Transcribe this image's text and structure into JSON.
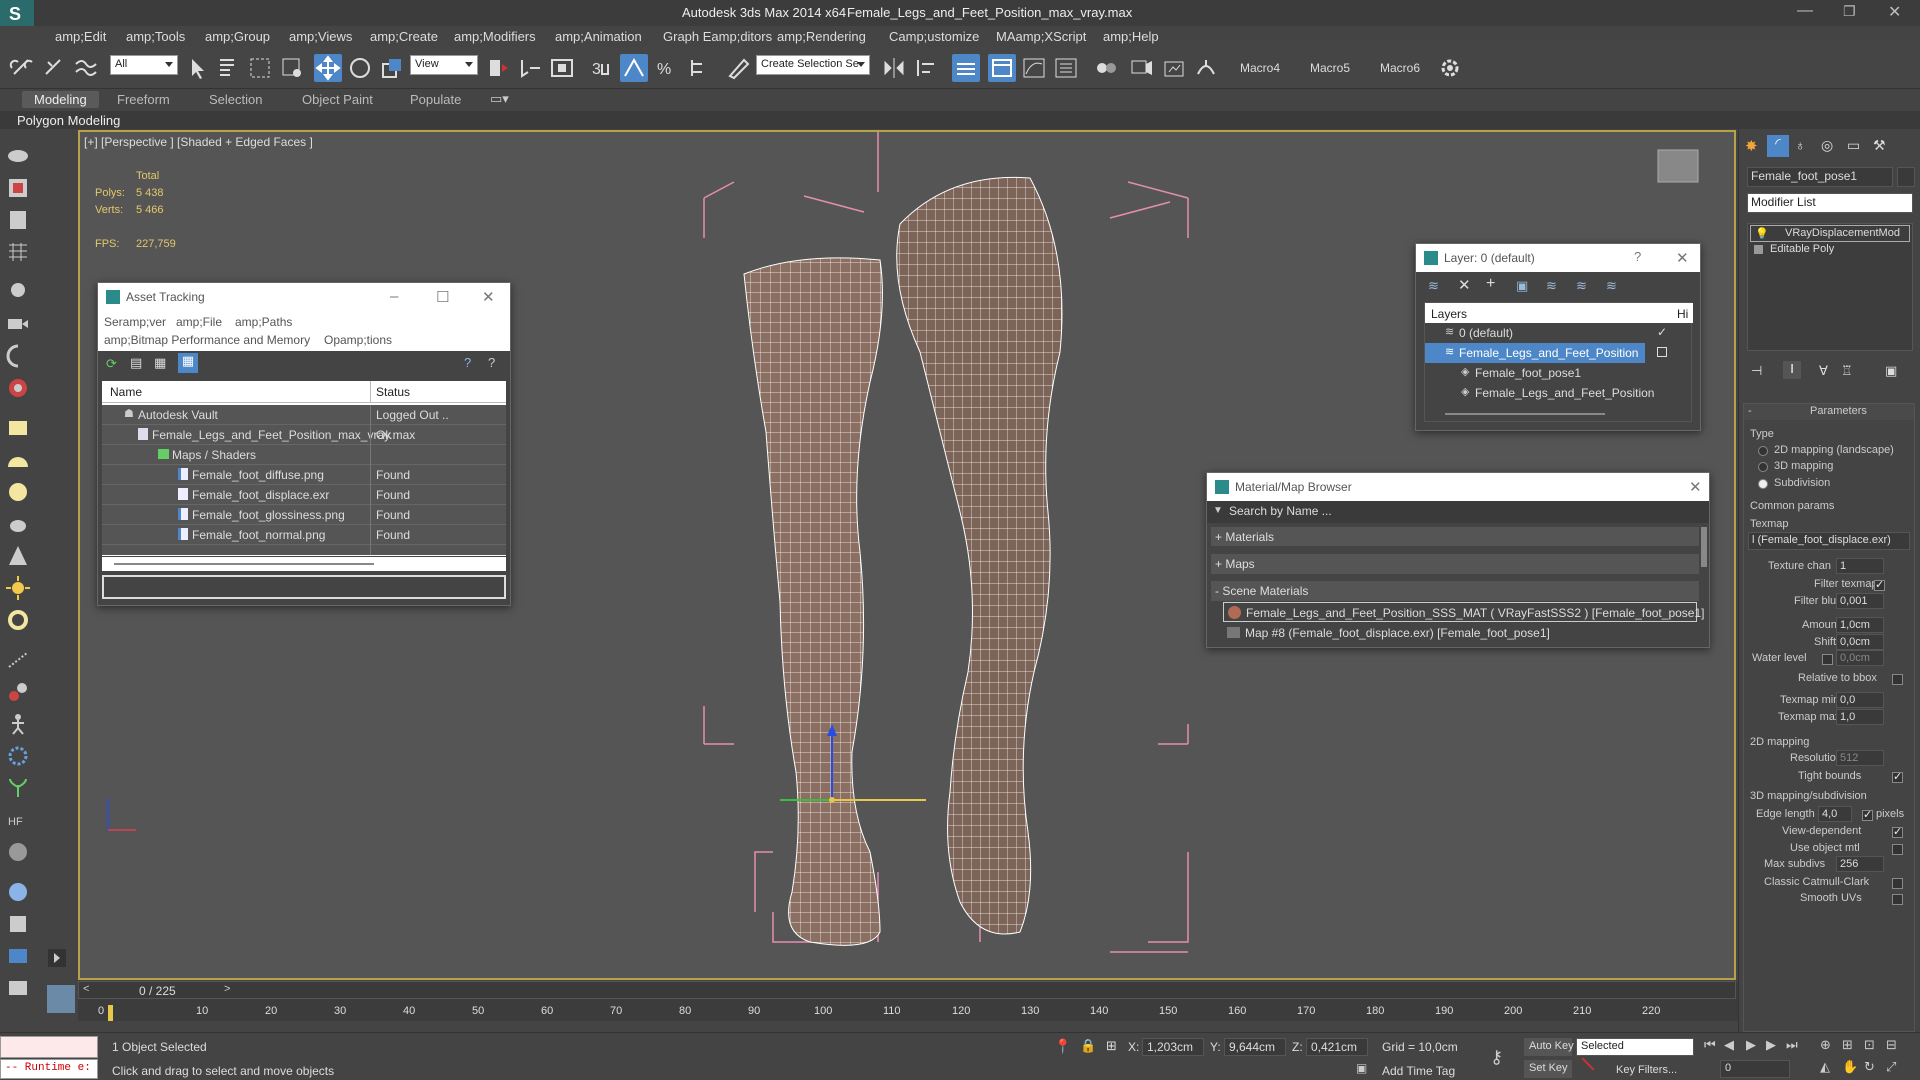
{
  "title": {
    "app": "Autodesk 3ds Max  2014 x64",
    "file": "Female_Legs_and_Feet_Position_max_vray.max"
  },
  "menu": [
    "amp;Edit",
    "amp;Tools",
    "amp;Group",
    "amp;Views",
    "amp;Create",
    "amp;Modifiers",
    "amp;Animation",
    "Graph Eamp;ditors",
    "amp;Rendering",
    "Camp;ustomize",
    "MAamp;XScript",
    "amp;Help"
  ],
  "toolbar": {
    "filter": "All",
    "ref_coord": "View",
    "selection_set": "Create Selection Se",
    "macros": [
      "Macro4",
      "Macro5",
      "Macro6"
    ]
  },
  "ribbon": {
    "tabs": [
      "Modeling",
      "Freeform",
      "Selection",
      "Object Paint",
      "Populate"
    ],
    "sub": "Polygon Modeling"
  },
  "viewport": {
    "label": "[+] [Perspective ] [Shaded + Edged Faces ]",
    "stats": {
      "total": "Total",
      "polys_label": "Polys:",
      "polys": "5 438",
      "verts_label": "Verts:",
      "verts": "5 466",
      "fps_label": "FPS:",
      "fps": "227,759"
    }
  },
  "asset_tracking": {
    "title": "Asset Tracking",
    "menu": [
      "Seramp;ver",
      "amp;File",
      "amp;Paths"
    ],
    "menu2": [
      "amp;Bitmap Performance and Memory",
      "Opamp;tions"
    ],
    "columns": [
      "Name",
      "Status"
    ],
    "rows": [
      {
        "name": "Autodesk Vault",
        "status": "Logged Out .."
      },
      {
        "name": "Female_Legs_and_Feet_Position_max_vray.max",
        "status": "Ok"
      },
      {
        "name": "Maps / Shaders",
        "status": ""
      },
      {
        "name": "Female_foot_diffuse.png",
        "status": "Found"
      },
      {
        "name": "Female_foot_displace.exr",
        "status": "Found"
      },
      {
        "name": "Female_foot_glossiness.png",
        "status": "Found"
      },
      {
        "name": "Female_foot_normal.png",
        "status": "Found"
      }
    ]
  },
  "layer": {
    "title": "Layer: 0 (default)",
    "header": "Layers",
    "header2": "Hi",
    "rows": [
      "0 (default)",
      "Female_Legs_and_Feet_Position",
      "Female_foot_pose1",
      "Female_Legs_and_Feet_Position"
    ]
  },
  "material_browser": {
    "title": "Material/Map Browser",
    "search": "Search by Name ...",
    "sections": [
      "+ Materials",
      "+ Maps",
      "- Scene Materials"
    ],
    "items": [
      "Female_Legs_and_Feet_Position_SSS_MAT ( VRayFastSSS2 ) [Female_foot_pose1]",
      "Map #8 (Female_foot_displace.exr) [Female_foot_pose1]"
    ]
  },
  "command_panel": {
    "object_name": "Female_foot_pose1",
    "modifier_list": "Modifier List",
    "stack": [
      "VRayDisplacementMod",
      "Editable Poly"
    ],
    "rollout": "Parameters",
    "type_label": "Type",
    "types": [
      "2D mapping (landscape)",
      "3D mapping",
      "Subdivision"
    ],
    "common_label": "Common params",
    "texmap_label": "Texmap",
    "texmap": "l (Female_foot_displace.exr)",
    "texture_chan_label": "Texture chan",
    "texture_chan": "1",
    "filter_texmap_label": "Filter texmap",
    "filter_blur_label": "Filter blur",
    "filter_blur": "0,001",
    "amount_label": "Amount",
    "amount": "1,0cm",
    "shift_label": "Shift",
    "shift": "0,0cm",
    "water_label": "Water level",
    "water": "0,0cm",
    "relative_label": "Relative to bbox",
    "texmap_min_label": "Texmap min",
    "texmap_min": "0,0",
    "texmap_max_label": "Texmap max",
    "texmap_max": "1,0",
    "mapping2d_label": "2D mapping",
    "resolution_label": "Resolution",
    "resolution": "512",
    "tight_label": "Tight bounds",
    "mapping3d_label": "3D mapping/subdivision",
    "edge_label": "Edge length",
    "edge": "4,0",
    "pixels": "pixels",
    "viewdep_label": "View-dependent",
    "useobj_label": "Use object mtl",
    "maxsub_label": "Max subdivs",
    "maxsub": "256",
    "catmull_label": "Classic Catmull-Clark",
    "smooth_label": "Smooth UVs"
  },
  "timeline": {
    "frame": "0 / 225",
    "ticks": [
      "0",
      "10",
      "20",
      "30",
      "40",
      "50",
      "60",
      "70",
      "80",
      "90",
      "100",
      "110",
      "120",
      "130",
      "140",
      "150",
      "160",
      "170",
      "180",
      "190",
      "200",
      "210",
      "220"
    ]
  },
  "status": {
    "runtime": "-- Runtime e:",
    "selected": "1 Object Selected",
    "hint": "Click and drag to select and move objects",
    "x_label": "X:",
    "x": "1,203cm",
    "y_label": "Y:",
    "y": "9,644cm",
    "z_label": "Z:",
    "z": "0,421cm",
    "grid": "Grid = 10,0cm",
    "add_time_tag": "Add Time Tag",
    "auto_key": "Auto Key",
    "set_key": "Set Key",
    "key_mode": "Selected",
    "key_filters": "Key Filters...",
    "frame_field": "0"
  }
}
